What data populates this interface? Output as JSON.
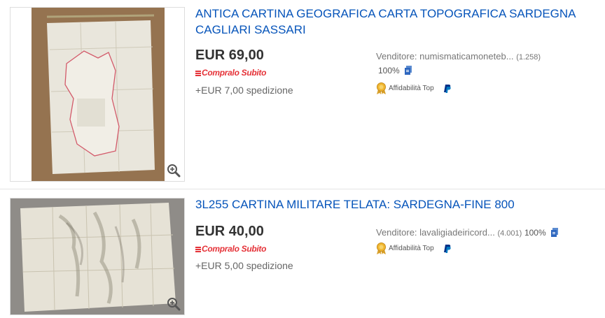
{
  "listings": [
    {
      "title": "ANTICA CARTINA GEOGRAFICA CARTA TOPOGRAFICA SARDEGNA CAGLIARI SASSARI",
      "price": "EUR 69,00",
      "buy_now": "Compralo Subito",
      "shipping": "+EUR 7,00 spedizione",
      "seller": "Venditore: numismaticamoneteb...",
      "feedback_count": "(1.258)",
      "positive": "100%",
      "top_rated": "Affidabilità Top",
      "icons": [
        "zoom-icon",
        "document-icon",
        "medal-icon",
        "paypal-icon"
      ]
    },
    {
      "title": "3L255 CARTINA MILITARE TELATA: SARDEGNA-FINE 800",
      "price": "EUR 40,00",
      "buy_now": "Compralo Subito",
      "shipping": "+EUR 5,00 spedizione",
      "seller": "Venditore: lavaligiadeiricord...",
      "feedback_count": "(4.001)",
      "positive": "100%",
      "top_rated": "Affidabilità Top",
      "icons": [
        "zoom-icon",
        "document-icon",
        "medal-icon",
        "paypal-icon"
      ]
    }
  ],
  "colors": {
    "link": "#0654ba",
    "buy_now": "#e53238",
    "paypal": "#003087"
  }
}
